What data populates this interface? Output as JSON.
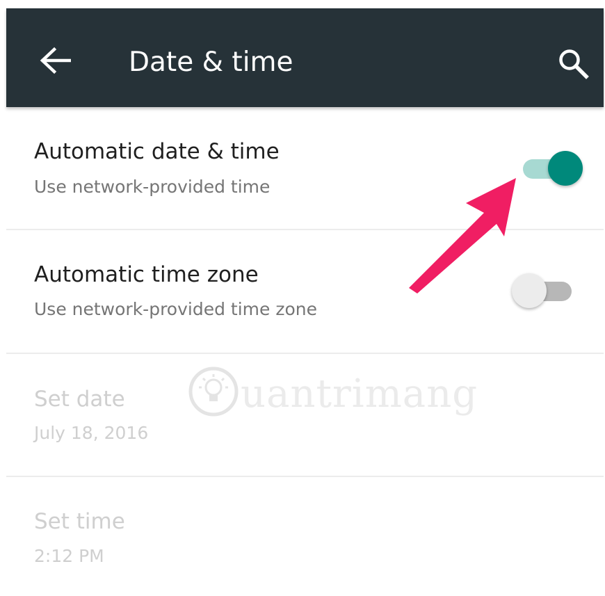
{
  "toolbar": {
    "title": "Date & time",
    "background_color": "#263238",
    "back_icon": "arrow-back-icon",
    "search_icon": "search-icon"
  },
  "settings": [
    {
      "title": "Automatic date & time",
      "subtitle": "Use network-provided time",
      "toggle": "on",
      "enabled": true
    },
    {
      "title": "Automatic time zone",
      "subtitle": "Use network-provided time zone",
      "toggle": "off",
      "enabled": true
    },
    {
      "title": "Set date",
      "subtitle": "July 18, 2016",
      "enabled": false
    },
    {
      "title": "Set time",
      "subtitle": "2:12 PM",
      "enabled": false
    }
  ],
  "annotation": {
    "type": "arrow",
    "color": "#f01e63",
    "points_to": "automatic-date-time-switch"
  },
  "watermark": {
    "text": "uantrimang",
    "icon": "lightbulb-icon"
  },
  "colors": {
    "accent": "#00897b",
    "accent_track": "#a7d9d2"
  }
}
